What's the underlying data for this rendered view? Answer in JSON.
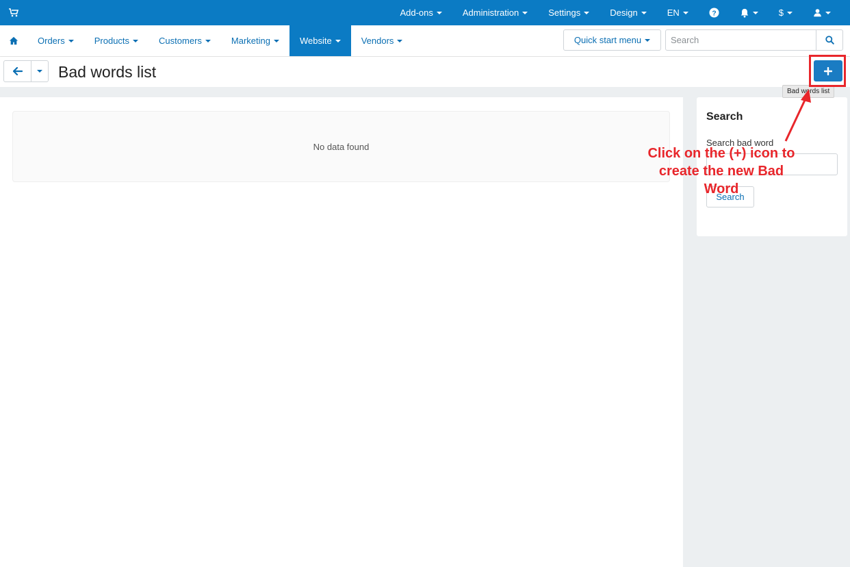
{
  "topbar": {
    "items": [
      {
        "label": "Add-ons"
      },
      {
        "label": "Administration"
      },
      {
        "label": "Settings"
      },
      {
        "label": "Design"
      },
      {
        "label": "EN"
      },
      {
        "label": "$"
      }
    ]
  },
  "mainnav": {
    "items": [
      {
        "label": "Orders"
      },
      {
        "label": "Products"
      },
      {
        "label": "Customers"
      },
      {
        "label": "Marketing"
      },
      {
        "label": "Website"
      },
      {
        "label": "Vendors"
      }
    ],
    "active": "Website",
    "quick_start_label": "Quick start menu",
    "search_placeholder": "Search"
  },
  "page": {
    "title": "Bad words list",
    "add_tooltip": "Bad words list",
    "empty_message": "No data found"
  },
  "sidebar": {
    "title": "Search",
    "field_label": "Search bad word",
    "field_value": "",
    "button_label": "Search"
  },
  "annotation": {
    "text": "Click on the (+) icon to create the new Bad Word"
  },
  "colors": {
    "brand_blue": "#0b7bc4",
    "link_blue": "#0b6fb3",
    "annotation_red": "#e8262b"
  },
  "icons": {
    "cart": "cart-icon",
    "help": "question-circle-icon",
    "bell": "bell-icon",
    "user": "user-icon",
    "home": "home-icon",
    "search": "search-icon",
    "back": "arrow-left-icon",
    "add": "plus-icon"
  }
}
